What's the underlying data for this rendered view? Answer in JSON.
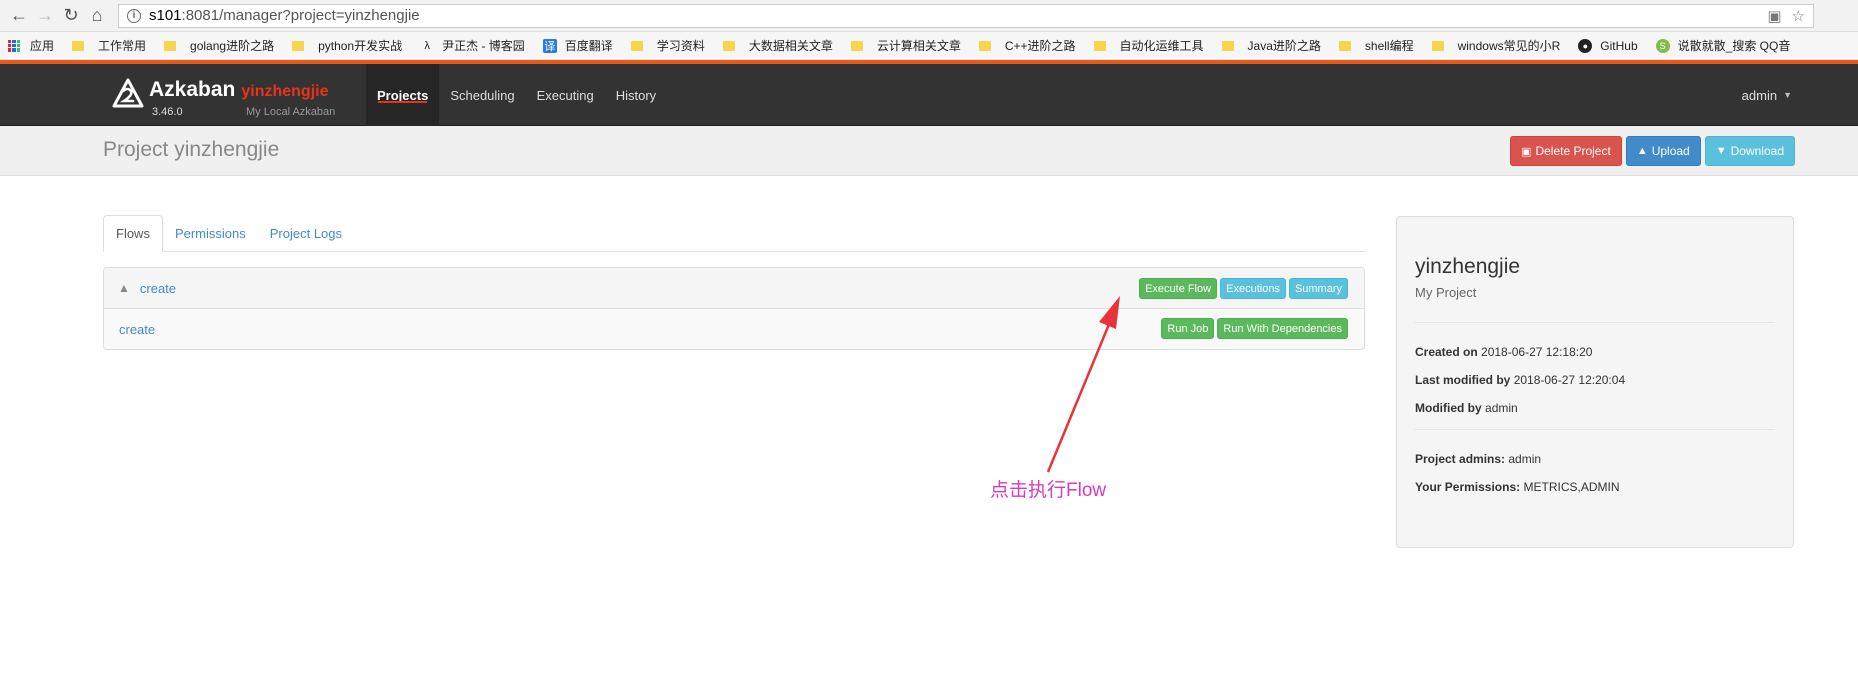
{
  "browser": {
    "url_host": "s101",
    "url_rest": ":8081/manager?project=yinzhengjie",
    "bookmarks": [
      "应用",
      "工作常用",
      "golang进阶之路",
      "python开发实战",
      "尹正杰 - 博客园",
      "百度翻译",
      "学习资料",
      "大数据相关文章",
      "云计算相关文章",
      "C++进阶之路",
      "自动化运维工具",
      "Java进阶之路",
      "shell编程",
      "windows常见的小R",
      "GitHub",
      "说散就散_搜索 QQ音"
    ]
  },
  "navbar": {
    "brand": "Azkaban",
    "instance": "yinzhengjie",
    "version": "3.46.0",
    "description": "My Local Azkaban",
    "links": [
      "Projects",
      "Scheduling",
      "Executing",
      "History"
    ],
    "user": "admin"
  },
  "header": {
    "title": "Project yinzhengjie",
    "delete_label": "Delete Project",
    "upload_label": "Upload",
    "download_label": "Download"
  },
  "tabs": [
    "Flows",
    "Permissions",
    "Project Logs"
  ],
  "flow": {
    "name": "create",
    "execute_label": "Execute Flow",
    "executions_label": "Executions",
    "summary_label": "Summary",
    "job": {
      "name": "create",
      "run_job_label": "Run Job",
      "run_deps_label": "Run With Dependencies"
    }
  },
  "sidebar": {
    "project_name": "yinzhengjie",
    "project_desc": "My Project",
    "created_label": "Created on",
    "created_value": "2018-06-27 12:18:20",
    "modified_label": "Last modified by",
    "modified_value": "2018-06-27 12:20:04",
    "modified_by_label": "Modified by",
    "modified_by_value": "admin",
    "admins_label": "Project admins:",
    "admins_value": "admin",
    "perms_label": "Your Permissions:",
    "perms_value": "METRICS,ADMIN"
  },
  "annotation": {
    "text": "点击执行Flow",
    "color": "#e8333a"
  }
}
